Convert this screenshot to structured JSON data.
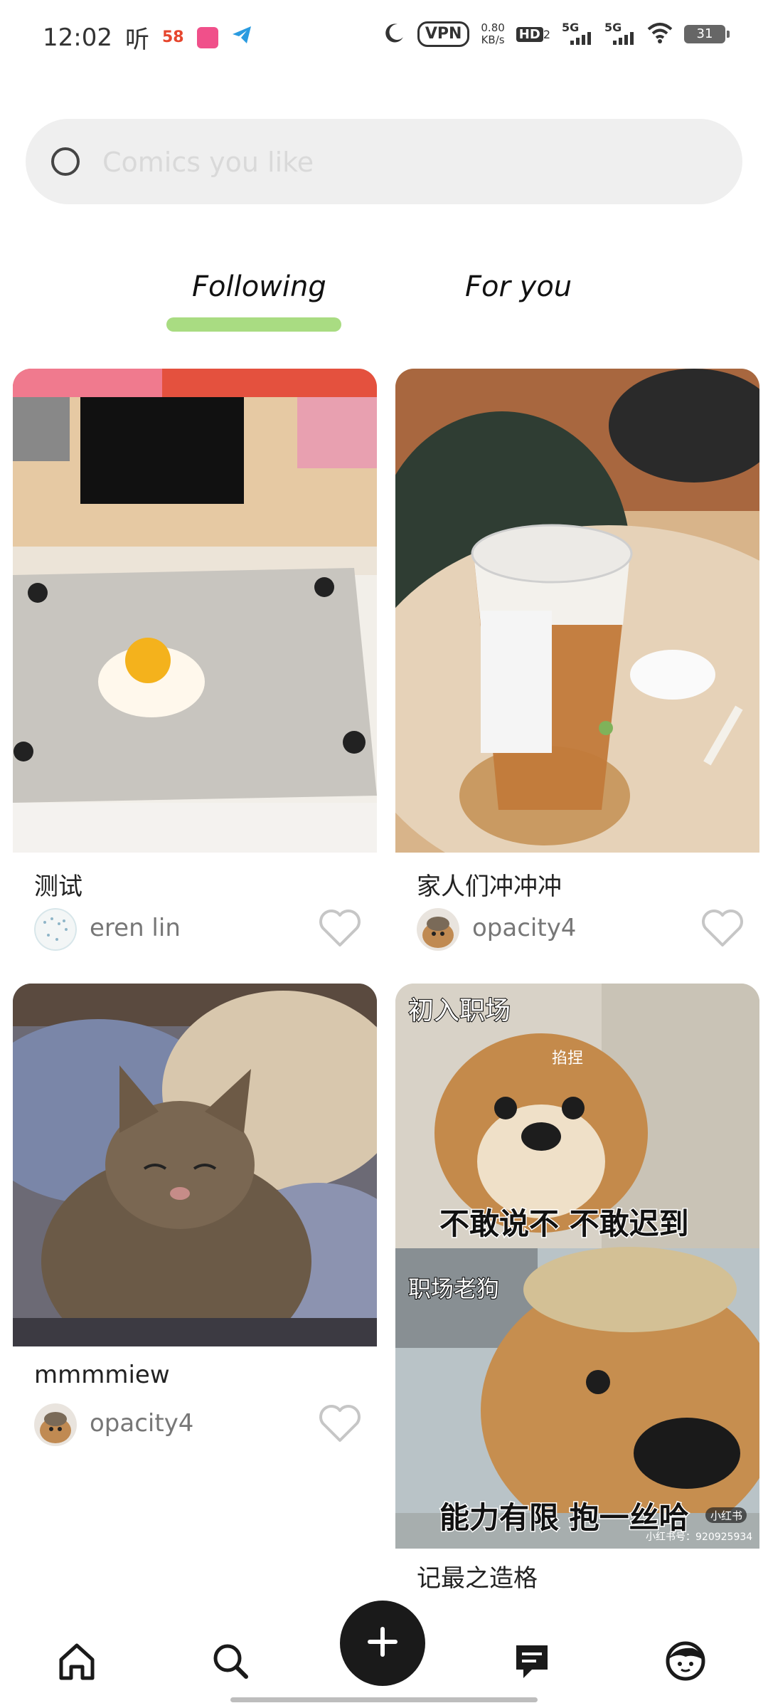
{
  "status_bar": {
    "time": "12:02",
    "app_icon_text": "听",
    "app_badge_58": "58",
    "vpn_label": "VPN",
    "net_speed_value": "0.80",
    "net_speed_unit": "KB/s",
    "hd_label": "HD",
    "hd_sub": "2",
    "sim1_label": "5G",
    "sim2_label": "5G",
    "battery_level": "31"
  },
  "search": {
    "placeholder": "Comics you like"
  },
  "tabs": [
    {
      "label": "Following",
      "active": true
    },
    {
      "label": "For you",
      "active": false
    }
  ],
  "accent_color": "#a9dc82",
  "feed": [
    {
      "title": "测试",
      "username": "eren lin",
      "liked": false,
      "image": "fried-egg-on-laptop-photo"
    },
    {
      "title": "家人们冲冲冲",
      "username": "opacity4",
      "liked": false,
      "image": "milk-tea-cup-photo"
    },
    {
      "title": "mmmmiew",
      "username": "opacity4",
      "liked": false,
      "image": "sleeping-cat-photo"
    },
    {
      "title": "记最之造格",
      "username": "",
      "liked": false,
      "image": "dog-meme-photo",
      "meme_text": {
        "top_label": "初入职场",
        "pinch_label": "掐捏",
        "middle_caption": "不敢说不 不敢迟到",
        "bottom_label": "职场老狗",
        "bottom_caption": "能力有限 抱一丝哈",
        "watermark_badge": "小红书",
        "watermark_id": "小红书号：920925934"
      }
    }
  ],
  "bottom_nav": {
    "icons": [
      "home-icon",
      "search-icon",
      "add-icon",
      "messages-icon",
      "profile-icon"
    ]
  }
}
